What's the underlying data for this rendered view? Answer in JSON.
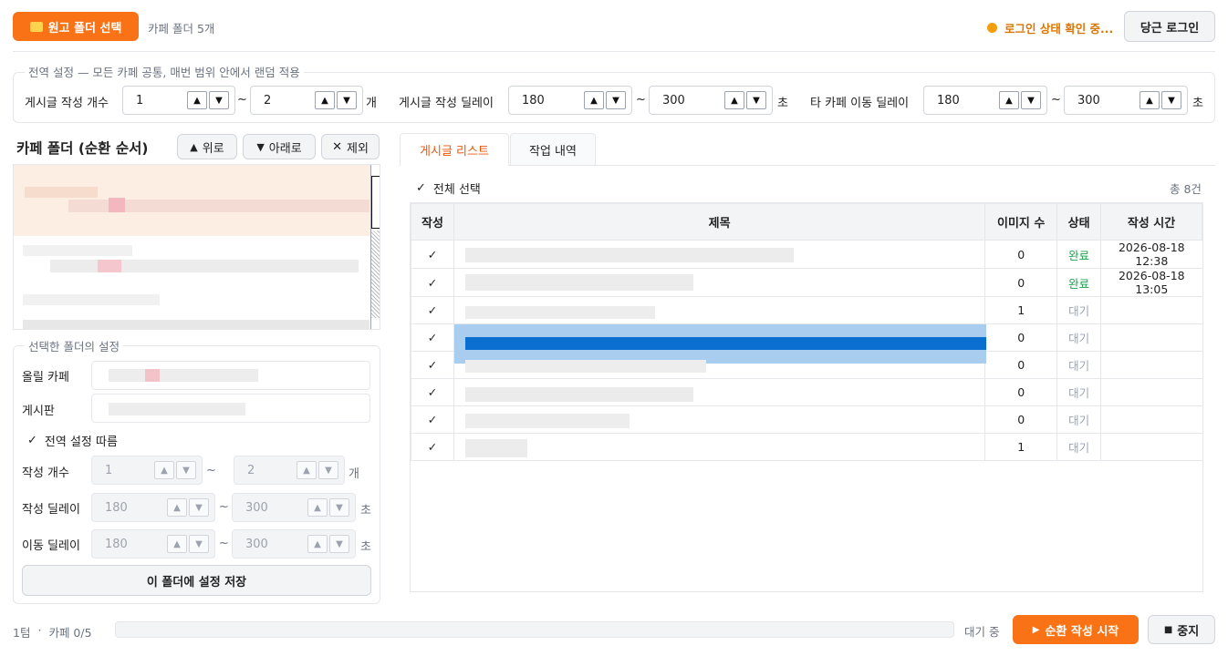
{
  "toolbar": {
    "select_folder_label": "원고 폴더 선택",
    "folder_count": "카페 폴더 5개",
    "login_status": "로그인 상태 확인 중...",
    "login_button": "당근 로그인"
  },
  "global": {
    "legend": "전역 설정  —  모든 카페 공통, 매번 범위 안에서 랜덤 적용",
    "post_count_label": "게시글 작성 개수",
    "post_count_min": "1",
    "post_count_max": "2",
    "post_count_unit": "개",
    "post_delay_label": "게시글 작성 딜레이",
    "post_delay_min": "180",
    "post_delay_max": "300",
    "post_delay_unit": "초",
    "move_delay_label": "타 카페 이동 딜레이",
    "move_delay_min": "180",
    "move_delay_max": "300",
    "move_delay_unit": "초",
    "tilde": "~"
  },
  "folders": {
    "title": "카페 폴더 (순환 순서)",
    "up_label": "위로",
    "down_label": "아래로",
    "remove_label": "제외"
  },
  "folder_settings": {
    "legend": "선택한 폴더의 설정",
    "cafe_label": "올릴 카페",
    "board_label": "게시판",
    "follow_global_label": "전역 설정 따름",
    "count_label": "작성 개수",
    "count_min": "1",
    "count_max": "2",
    "count_unit": "개",
    "delay_label": "작성 딜레이",
    "delay_min": "180",
    "delay_max": "300",
    "delay_unit": "초",
    "move_label": "이동 딜레이",
    "move_min": "180",
    "move_max": "300",
    "move_unit": "초",
    "save_label": "이 폴더에 설정 저장"
  },
  "tabs": {
    "posts": "게시글 리스트",
    "history": "작업 내역"
  },
  "posts": {
    "select_all": "전체 선택",
    "total": "총 8건",
    "headers": [
      "작성",
      "제목",
      "이미지 수",
      "상태",
      "작성 시간"
    ],
    "rows": [
      {
        "images": "0",
        "status": "완료",
        "time": "2026-08-18 12:38"
      },
      {
        "images": "0",
        "status": "완료",
        "time": "2026-08-18 13:05"
      },
      {
        "images": "1",
        "status": "대기",
        "time": ""
      },
      {
        "images": "0",
        "status": "대기",
        "time": ""
      },
      {
        "images": "0",
        "status": "대기",
        "time": ""
      },
      {
        "images": "0",
        "status": "대기",
        "time": ""
      },
      {
        "images": "0",
        "status": "대기",
        "time": ""
      },
      {
        "images": "1",
        "status": "대기",
        "time": ""
      }
    ]
  },
  "footer": {
    "round": "1텀",
    "separator": "·",
    "cafe_progress": "카페 0/5",
    "progress": 0,
    "state": "대기 중",
    "start_label": "순환 작성 시작",
    "stop_label": "중지"
  },
  "colors": {
    "accent": "#f97316",
    "done": "#16a34a",
    "wait": "#9ca3af"
  }
}
